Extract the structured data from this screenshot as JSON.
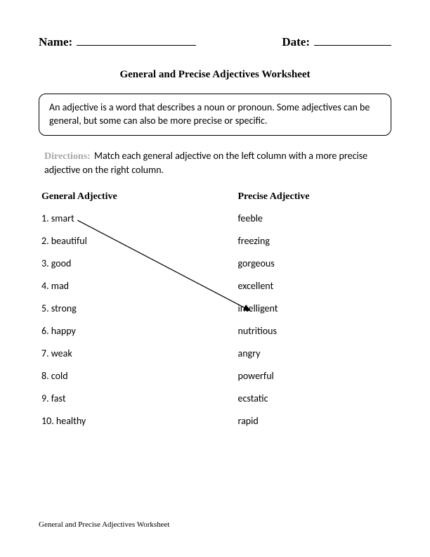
{
  "header": {
    "name_label": "Name:",
    "date_label": "Date:"
  },
  "title": "General and Precise Adjectives Worksheet",
  "definition": "An adjective is a word that describes a noun or pronoun. Some adjectives can be general, but some can also be more precise or specific.",
  "directions_label": "Directions:",
  "directions_text": " Match each general adjective on the left column with a more precise adjective on the right column.",
  "columns": {
    "left_header": "General Adjective",
    "right_header": "Precise Adjective",
    "left": [
      "1. smart",
      "2. beautiful",
      "3. good",
      "4. mad",
      "5. strong",
      "6. happy",
      "7. weak",
      "8. cold",
      "9. fast",
      "10. healthy"
    ],
    "right": [
      "feeble",
      "freezing",
      "gorgeous",
      "excellent",
      "intelligent",
      "nutritious",
      "angry",
      "powerful",
      "ecstatic",
      "rapid"
    ]
  },
  "footer": "General and Precise Adjectives Worksheet"
}
